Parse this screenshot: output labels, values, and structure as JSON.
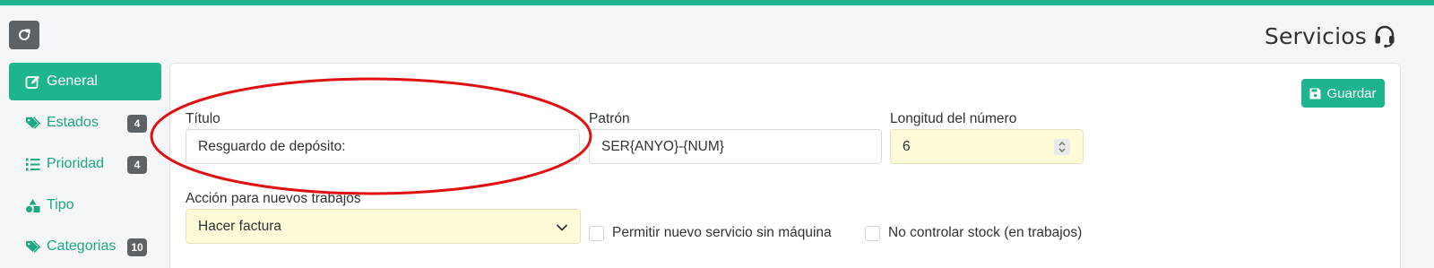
{
  "header": {
    "title": "Servicios",
    "refresh_icon": "refresh-icon",
    "help_icon": "headset-icon"
  },
  "colors": {
    "accent": "#1eb48e",
    "badge": "#5d6266",
    "highlight_field": "#fefcd8",
    "annotation": "#e01010"
  },
  "sidebar": {
    "items": [
      {
        "label": "General",
        "icon": "edit-icon",
        "active": true
      },
      {
        "label": "Estados",
        "icon": "tags-icon",
        "badge": "4"
      },
      {
        "label": "Prioridad",
        "icon": "list-ol-icon",
        "badge": "4"
      },
      {
        "label": "Tipo",
        "icon": "shapes-icon"
      },
      {
        "label": "Categorias",
        "icon": "tags-icon",
        "badge": "10"
      }
    ]
  },
  "form": {
    "save_label": "Guardar",
    "titulo": {
      "label": "Título",
      "value": "Resguardo de depósito:"
    },
    "patron": {
      "label": "Patrón",
      "value": "SER{ANYO}-{NUM}"
    },
    "longitud": {
      "label": "Longitud del número",
      "value": "6"
    },
    "accion": {
      "label": "Acción para nuevos trabajos",
      "selected": "Hacer factura"
    },
    "checkbox_maquina": {
      "label": "Permitir nuevo servicio sin máquina",
      "checked": false
    },
    "checkbox_stock": {
      "label": "No controlar stock (en trabajos)",
      "checked": false
    }
  }
}
